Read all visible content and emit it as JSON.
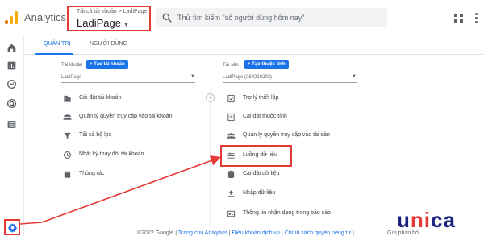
{
  "header": {
    "app_name": "Analytics",
    "account_path": "Tất cả tài khoản > LadiPage",
    "account_name": "LadiPage",
    "search_placeholder": "Thử tìm kiếm \"số người dùng hôm nay\""
  },
  "tabs": [
    {
      "label": "QUẢN TRỊ",
      "active": true
    },
    {
      "label": "NGƯỜI DÙNG",
      "active": false
    }
  ],
  "account_column": {
    "label": "Tài khoản",
    "create_button": "+ Tạo tài khoản",
    "selected": "LadiPage",
    "items": [
      {
        "label": "Cài đặt tài khoản",
        "icon": "building-icon"
      },
      {
        "label": "Quản lý quyền truy cập vào tài khoản",
        "icon": "people-icon"
      },
      {
        "label": "Tất cả bộ lọc",
        "icon": "filter-icon"
      },
      {
        "label": "Nhật ký thay đổi tài khoản",
        "icon": "history-icon"
      },
      {
        "label": "Thùng rác",
        "icon": "trash-icon"
      }
    ]
  },
  "property_column": {
    "label": "Tài sản",
    "create_button": "+ Tạo thuộc tính",
    "selected": "LadiPage (264210293)",
    "items": [
      {
        "label": "Trợ lý thiết lập",
        "icon": "checklist-icon"
      },
      {
        "label": "Cài đặt thuộc tính",
        "icon": "document-icon"
      },
      {
        "label": "Quản lý quyền truy cập vào tài sản",
        "icon": "people-icon"
      },
      {
        "label": "Luồng dữ liệu",
        "icon": "data-stream-icon"
      },
      {
        "label": "Cài đặt dữ liệu",
        "icon": "database-icon"
      },
      {
        "label": "Nhập dữ liệu",
        "icon": "upload-icon"
      },
      {
        "label": "Thông tin nhận dạng trong báo cáo",
        "icon": "reporting-identity-icon"
      }
    ]
  },
  "footer": {
    "copyright": "©2022 Google |",
    "link1": "Trang chủ Analytics",
    "sep1": "|",
    "link2": "Điều khoản dịch vụ",
    "sep2": "|",
    "link3": "Chính sách quyền riêng tư",
    "sep3": "|",
    "feedback": "Gửi phản hồi"
  },
  "watermark": {
    "left": "u",
    "middle": "ni",
    "right": "ca"
  },
  "colors": {
    "accent": "#1a73e8",
    "highlight": "#e53935",
    "brand_navy": "#1a237e"
  }
}
